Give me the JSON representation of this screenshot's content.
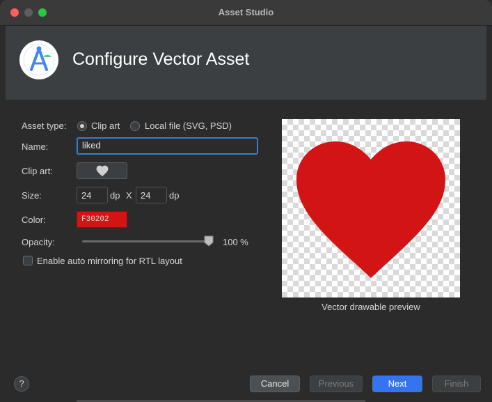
{
  "window": {
    "title": "Asset Studio"
  },
  "header": {
    "title": "Configure Vector Asset",
    "logo_icon": "android-studio-logo-icon"
  },
  "form": {
    "asset_type_label": "Asset type:",
    "asset_type_options": [
      "Clip art",
      "Local file (SVG, PSD)"
    ],
    "asset_type_selected": "Clip art",
    "name_label": "Name:",
    "name_value": "liked",
    "clip_art_label": "Clip art:",
    "clip_art_icon": "heart-icon",
    "size_label": "Size:",
    "width_value": "24",
    "height_value": "24",
    "unit": "dp",
    "size_separator": "X",
    "color_label": "Color:",
    "color_value": "F30202",
    "opacity_label": "Opacity:",
    "opacity_value": "100 %",
    "opacity_percent": 100,
    "auto_mirror_label": "Enable auto mirroring for RTL layout",
    "auto_mirror_checked": false
  },
  "preview": {
    "caption": "Vector drawable preview",
    "heart_color": "#d21414"
  },
  "footer": {
    "help_label": "?",
    "cancel_label": "Cancel",
    "previous_label": "Previous",
    "next_label": "Next",
    "finish_label": "Finish"
  }
}
